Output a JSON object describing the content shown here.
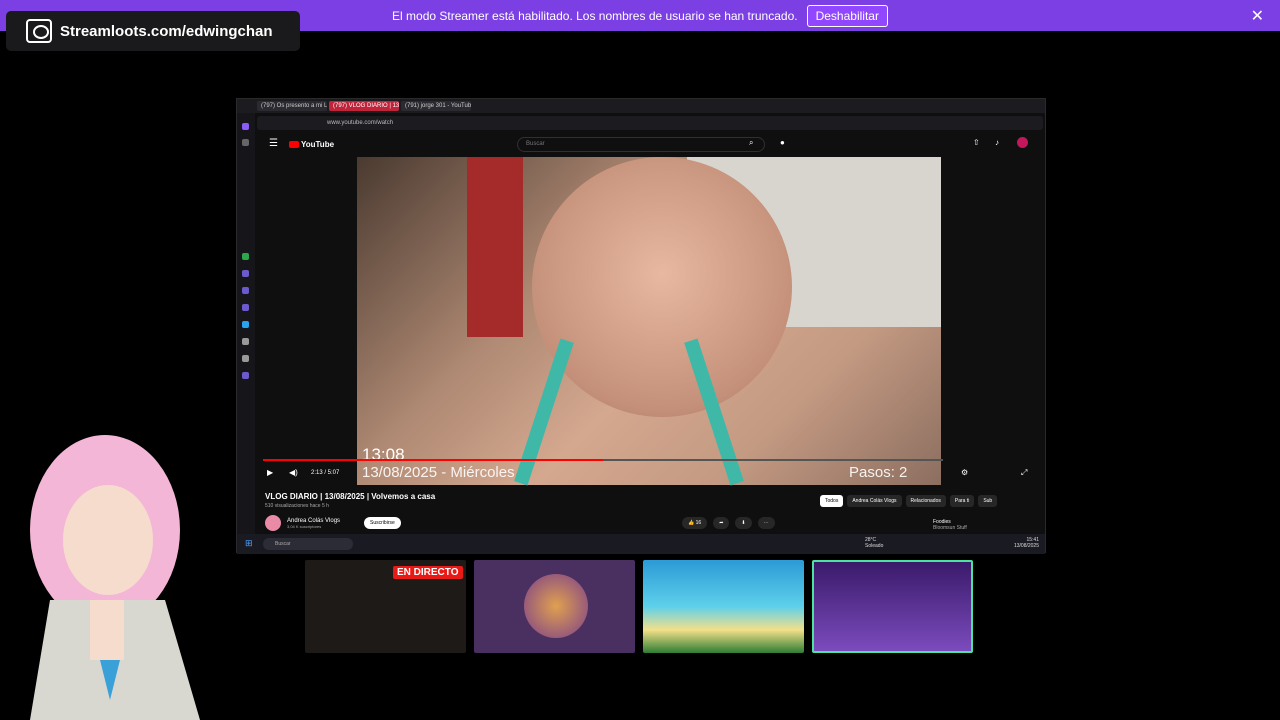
{
  "banner": {
    "text": "El modo Streamer está habilitado. Los nombres de usuario se han truncado.",
    "button": "Deshabilitar",
    "close": "✕"
  },
  "streamloots": {
    "label": "Streamloots.com/edwingchan"
  },
  "browser": {
    "tabs": [
      "(797) Os presento a mi L...",
      "(797) VLOG DIARIO | 13/...",
      "(791) jorge 301 - YouTube"
    ],
    "url": "www.youtube.com/watch"
  },
  "youtube": {
    "logo": "YouTube",
    "search_placeholder": "Buscar",
    "overlay_time": "13:08",
    "overlay_date": "13/08/2025 - Miércoles",
    "overlay_steps": "Pasos: 2",
    "progress": 0.5,
    "time_display": "2:13 / 5:07",
    "video_title": "VLOG DIARIO | 13/08/2025 | Volvemos a casa",
    "meta": "510 visualizaciones  hace 5 h",
    "channel": "Andrea Colás Vlogs",
    "subscribers": "3,04 K suscriptores",
    "subscribe": "Suscribirse",
    "likes": "16",
    "chips": [
      "Todos",
      "Andrea Colás Vlogs",
      "Relacionados",
      "Para ti",
      "Sub"
    ],
    "related_title": "Foodies",
    "related_channel": "Bloomsun Stuff"
  },
  "taskbar": {
    "search": "Buscar",
    "temp": "28°C",
    "weather": "Soleado",
    "time": "15:41",
    "date": "13/08/2025"
  },
  "thumbnails": {
    "live_badge": "EN DIRECTO"
  },
  "colors": {
    "banner": "#7b3fe4",
    "yt_red": "#ff0000",
    "live": "#e91916"
  }
}
